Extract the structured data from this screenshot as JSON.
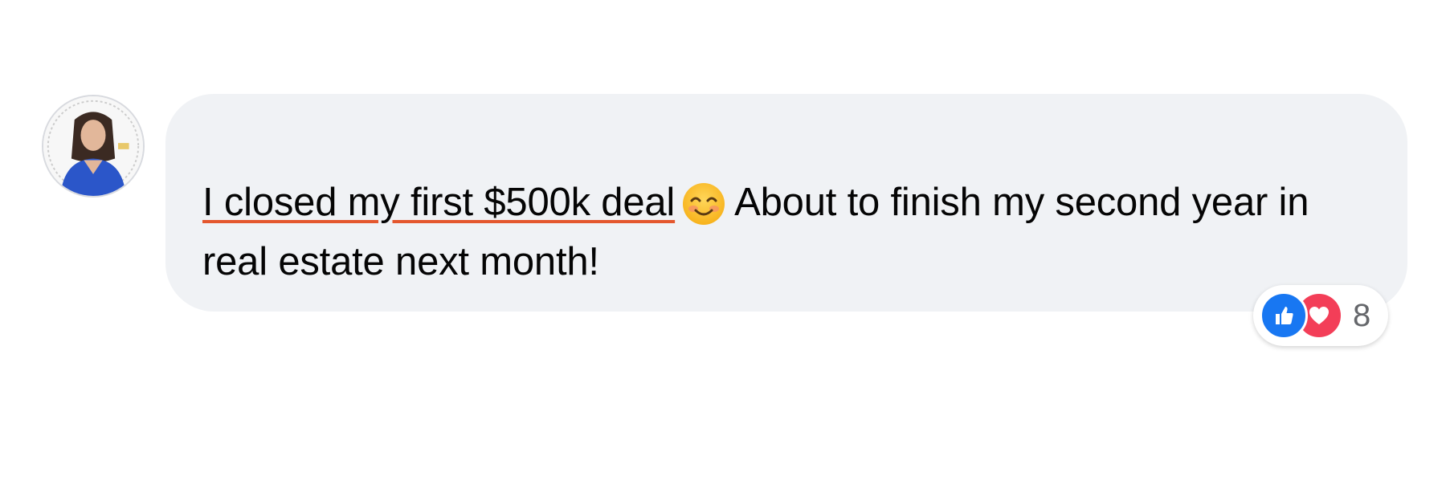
{
  "comment": {
    "author_avatar": "profile-photo",
    "text_highlighted": "I closed my first $500k deal",
    "emoji": "smiling-face-with-smiling-eyes",
    "text_rest": "About to finish my second year in real estate next month!",
    "underline_color": "#e4572e"
  },
  "reactions": {
    "icons": [
      "like-icon",
      "love-icon"
    ],
    "count": "8",
    "like_color": "#1877f2",
    "love_color": "#f33e58"
  }
}
